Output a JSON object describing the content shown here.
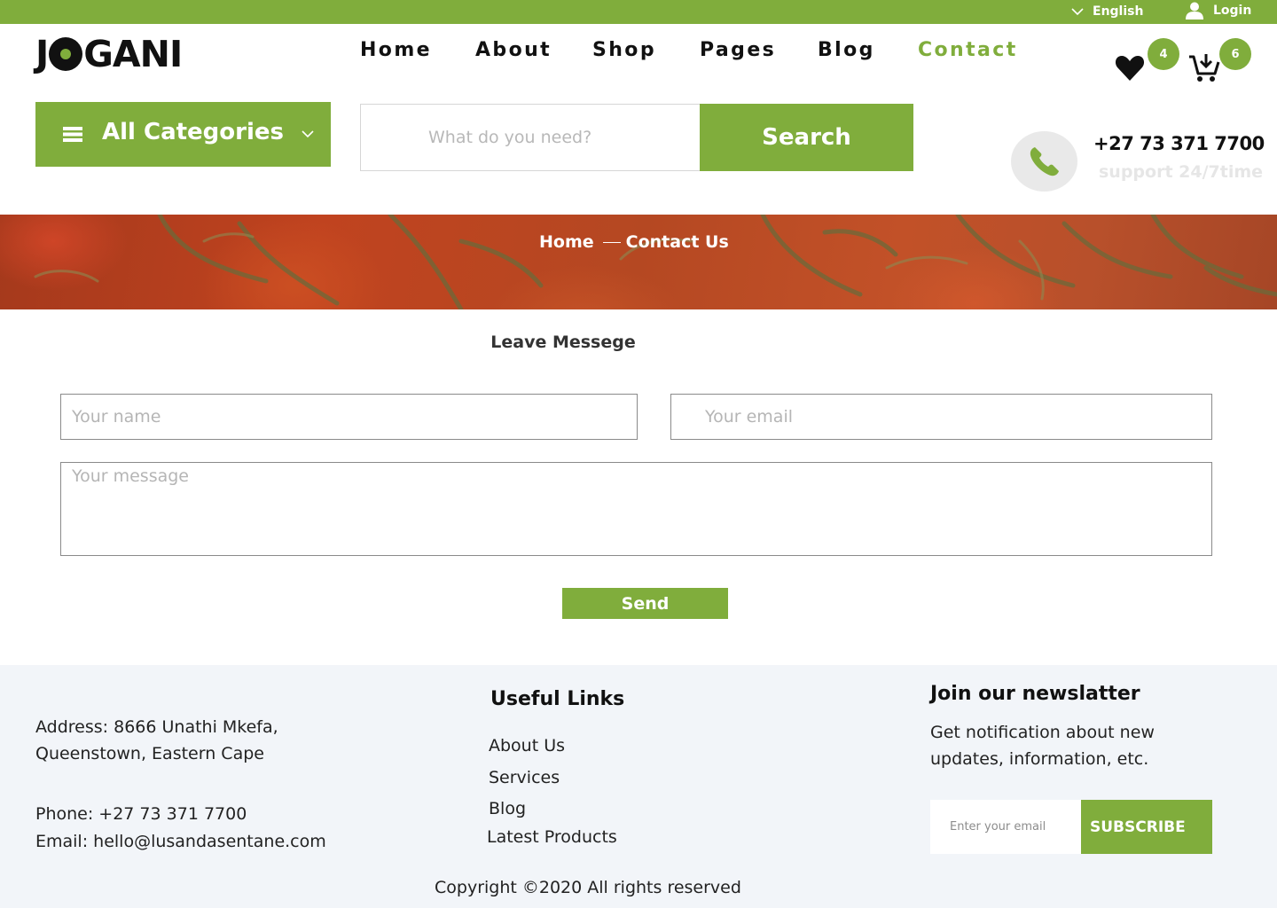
{
  "topbar": {
    "language": "English",
    "login": "Login"
  },
  "header": {
    "logo": {
      "before": "J",
      "after": "GANI"
    },
    "nav": [
      {
        "label": "Home",
        "active": false
      },
      {
        "label": "About",
        "active": false
      },
      {
        "label": "Shop",
        "active": false
      },
      {
        "label": "Pages",
        "active": false
      },
      {
        "label": "Blog",
        "active": false
      },
      {
        "label": "Contact",
        "active": true
      }
    ],
    "wishlist_count": "4",
    "cart_count": "6"
  },
  "search": {
    "categories_label": "All Categories",
    "placeholder": "What do you need?",
    "button": "Search"
  },
  "support": {
    "phone": "+27 73 371 7700",
    "subtitle": "support 24/7time"
  },
  "breadcrumb": {
    "home": "Home",
    "current": "Contact Us"
  },
  "contact_form": {
    "title": "Leave Messege",
    "name_placeholder": "Your name",
    "email_placeholder": "Your email",
    "message_placeholder": "Your message",
    "send": "Send"
  },
  "footer": {
    "address": "Address: 8666 Unathi Mkefa, Queenstown, Eastern Cape",
    "phone": "Phone: +27 73 371 7700",
    "email": "Email: hello@lusandasentane.com",
    "links_title": "Useful Links",
    "links": [
      "About Us",
      "Services",
      "Blog",
      "Latest Products"
    ],
    "newsletter_title": "Join our newslatter",
    "newsletter_text": "Get notification about new updates, information, etc.",
    "newsletter_placeholder": "Enter your email",
    "subscribe": "SUBSCRIBE",
    "copyright": "Copyright ©2020 All rights reserved"
  },
  "colors": {
    "accent": "#80ad3c",
    "footer_bg": "#f2f5f9",
    "hero": "#b8441f"
  },
  "icons": [
    "chevron-down-icon",
    "user-icon",
    "heart-icon",
    "cart-icon",
    "menu-icon",
    "phone-icon"
  ]
}
